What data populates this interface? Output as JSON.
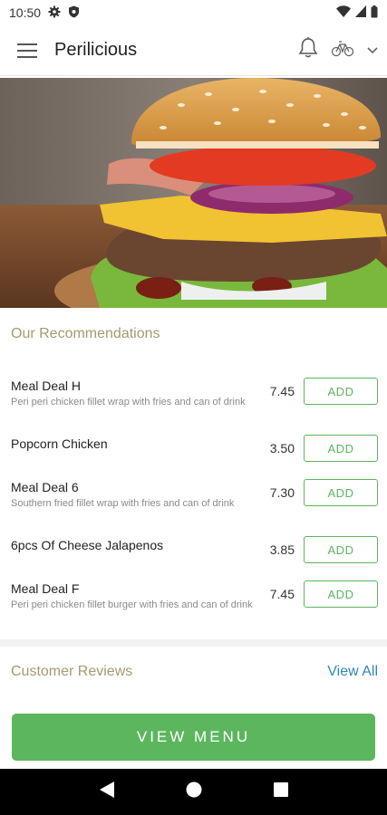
{
  "status_bar": {
    "time": "10:50"
  },
  "app_bar": {
    "title": "Perilicious"
  },
  "recommendations": {
    "title": "Our Recommendations",
    "items": [
      {
        "name": "Meal Deal H",
        "description": "Peri peri chicken fillet wrap with fries and can of drink",
        "price": "7.45",
        "add_label": "ADD"
      },
      {
        "name": "Popcorn Chicken",
        "description": "",
        "price": "3.50",
        "add_label": "ADD"
      },
      {
        "name": "Meal Deal 6",
        "description": "Southern fried fillet wrap with fries and can of drink",
        "price": "7.30",
        "add_label": "ADD"
      },
      {
        "name": "6pcs Of Cheese Jalapenos",
        "description": "",
        "price": "3.85",
        "add_label": "ADD"
      },
      {
        "name": "Meal Deal F",
        "description": "Peri peri chicken fillet burger with fries and can of drink",
        "price": "7.45",
        "add_label": "ADD"
      }
    ]
  },
  "reviews": {
    "title": "Customer Reviews",
    "view_all_label": "View All"
  },
  "cta": {
    "label": "VIEW MENU"
  },
  "colors": {
    "accent_green": "#5cb65e",
    "section_title": "#a49a6e",
    "link_blue": "#2f86b8"
  },
  "icons": [
    "settings-icon",
    "shield-icon",
    "wifi-icon",
    "signal-icon",
    "battery-icon",
    "hamburger-menu-icon",
    "bell-icon",
    "bikes-icon",
    "chevron-down-icon",
    "back-icon",
    "home-icon",
    "recents-icon"
  ]
}
